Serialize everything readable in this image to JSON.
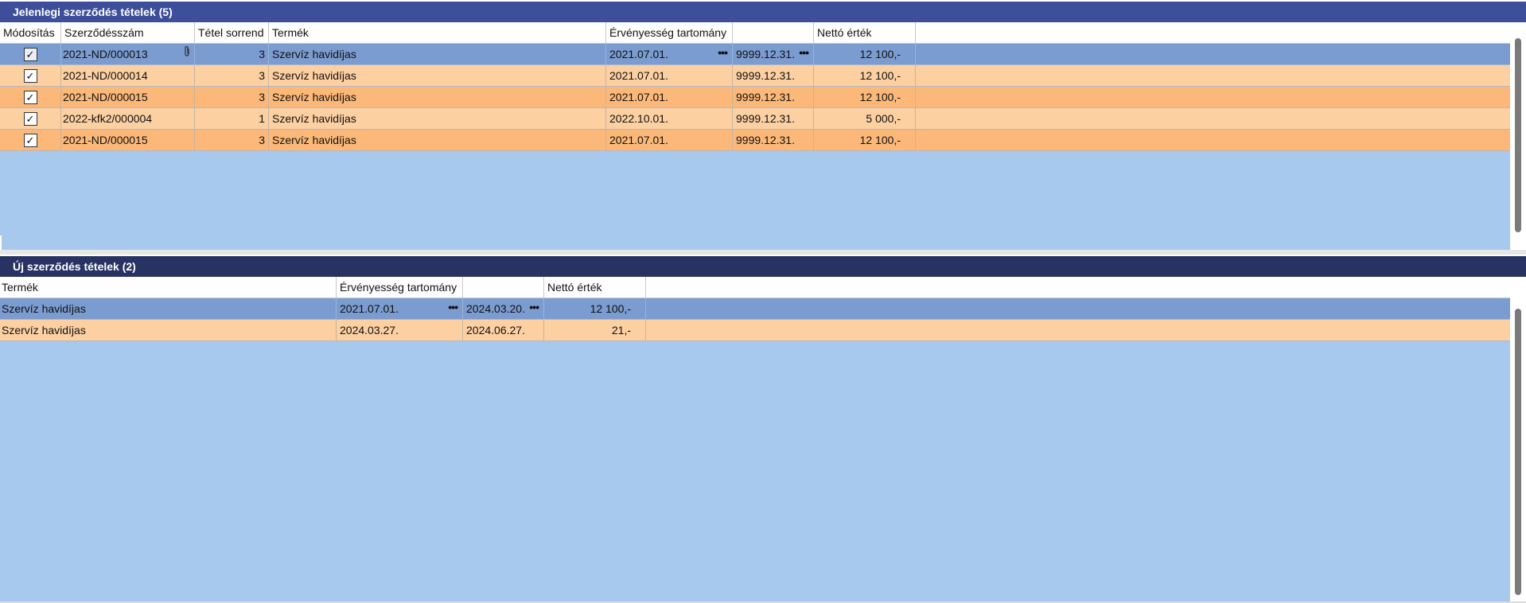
{
  "top_panel": {
    "title": "Jelenlegi szerződés tételek (5)",
    "columns": [
      "Módosítás",
      "Szerződésszám",
      "Tétel sorrend",
      "Termék",
      "Érvényesség tartomány",
      "",
      "Nettó érték"
    ],
    "rows": [
      {
        "checked": "✓",
        "contract": "2021-ND/000013",
        "order": "3",
        "product": "Szervíz havidíjas",
        "valid_from": "2021.07.01.",
        "valid_to": "9999.12.31.",
        "net": "12 100,-"
      },
      {
        "checked": "✓",
        "contract": "2021-ND/000014",
        "order": "3",
        "product": "Szervíz havidíjas",
        "valid_from": "2021.07.01.",
        "valid_to": "9999.12.31.",
        "net": "12 100,-"
      },
      {
        "checked": "✓",
        "contract": "2021-ND/000015",
        "order": "3",
        "product": "Szervíz havidíjas",
        "valid_from": "2021.07.01.",
        "valid_to": "9999.12.31.",
        "net": "12 100,-"
      },
      {
        "checked": "✓",
        "contract": "2022-kfk2/000004",
        "order": "1",
        "product": "Szervíz havidíjas",
        "valid_from": "2022.10.01.",
        "valid_to": "9999.12.31.",
        "net": "5 000,-"
      },
      {
        "checked": "✓",
        "contract": "2021-ND/000015",
        "order": "3",
        "product": "Szervíz havidíjas",
        "valid_from": "2021.07.01.",
        "valid_to": "9999.12.31.",
        "net": "12 100,-"
      }
    ]
  },
  "bottom_panel": {
    "title": "Új szerződés tételek (2)",
    "columns": [
      "Termék",
      "Érvényesség tartomány",
      "",
      "Nettó érték"
    ],
    "rows": [
      {
        "product": "Szervíz havidíjas",
        "valid_from": "2021.07.01.",
        "valid_to": "2024.03.20.",
        "net": "12 100,-"
      },
      {
        "product": "Szervíz havidíjas",
        "valid_from": "2024.03.27.",
        "valid_to": "2024.06.27.",
        "net": "21,-"
      }
    ]
  },
  "icons": {
    "ellipsis": "ellipsis-icon",
    "attachment": "paperclip-icon",
    "check": "checkbox-icon"
  },
  "colors": {
    "title_top": "#3d4f9b",
    "title_bottom": "#283363",
    "row_selected": "#7b9cd0",
    "row_light": "#fdd0a2",
    "row_dark": "#fcb878",
    "background": "#a7c9ee"
  }
}
